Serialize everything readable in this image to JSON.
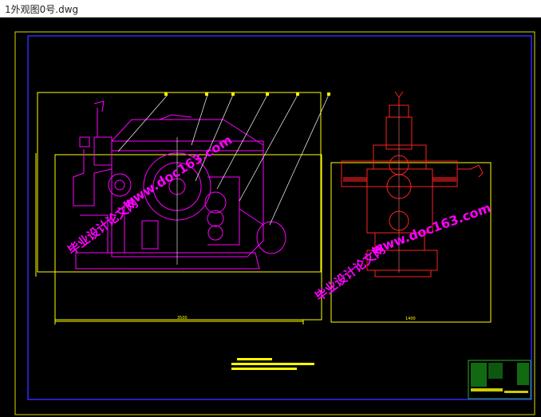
{
  "window": {
    "title": "1外观图0号.dwg"
  },
  "drawing": {
    "background": "#000000",
    "border_color": "#2a2aff",
    "outline_color": "#ffff00",
    "part_color": "#ff00ff",
    "side_color": "#ff2020",
    "watermark_color": "#ff00ff"
  },
  "watermarks": [
    {
      "url": "www.doc163.com",
      "site": "毕业设计论文网"
    },
    {
      "url": "www.doc163.com",
      "site": "毕业设计论文网"
    }
  ],
  "dimensions": {
    "front_width": "3500",
    "side_width": "1400"
  }
}
